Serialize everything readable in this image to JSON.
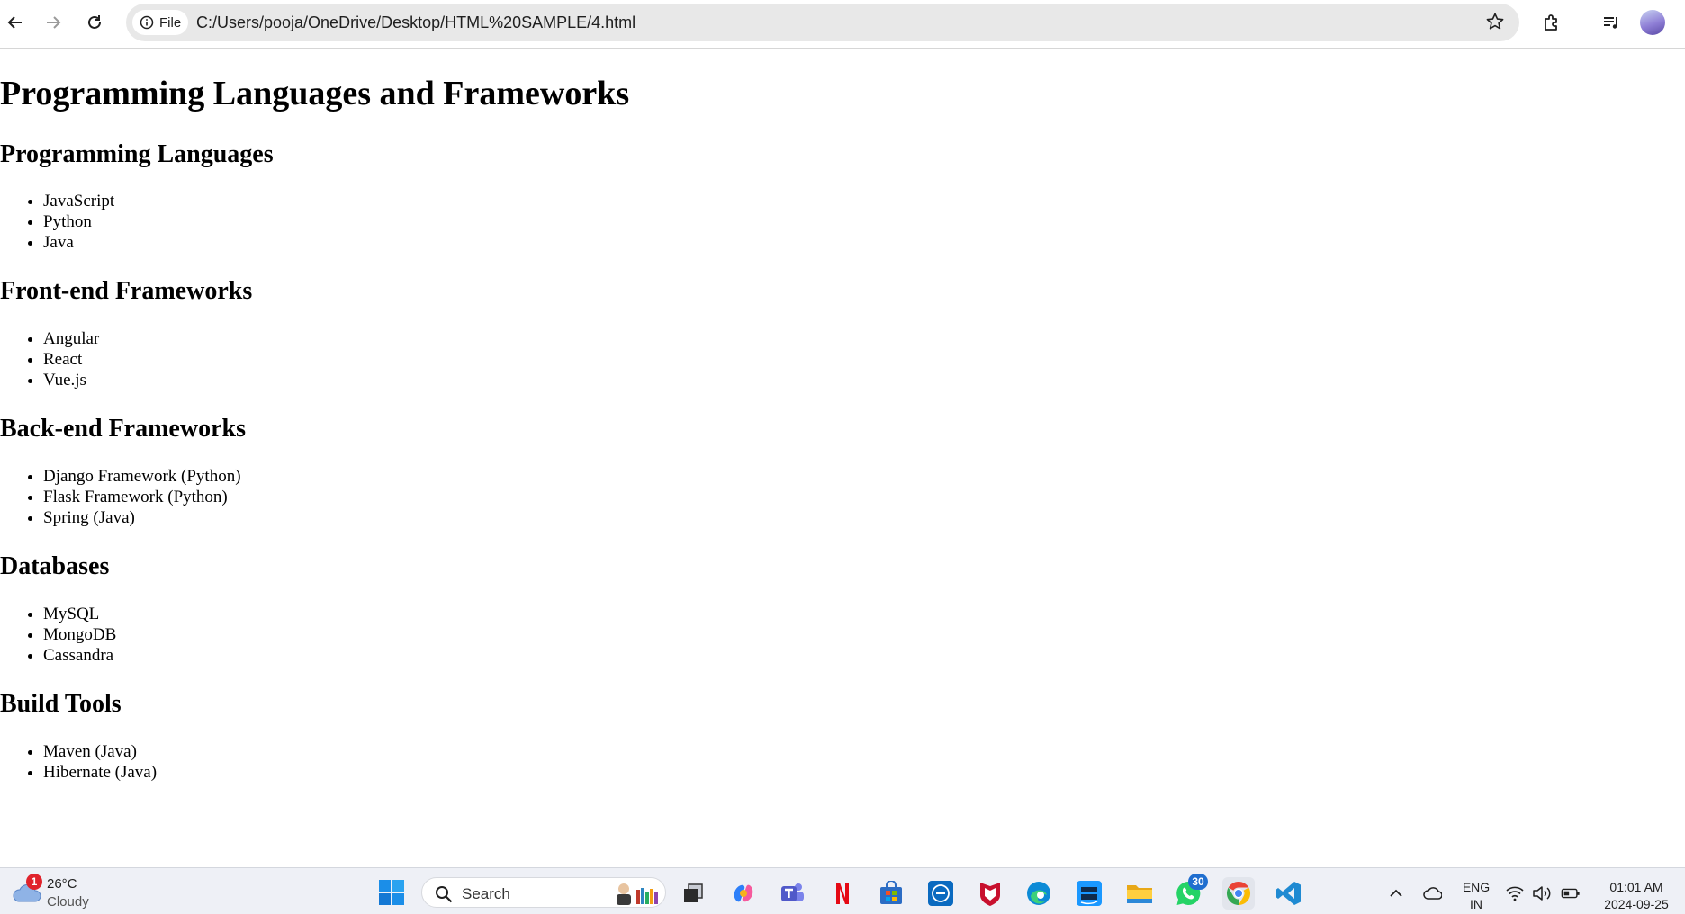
{
  "browser": {
    "site_chip_label": "File",
    "url": "C:/Users/pooja/OneDrive/Desktop/HTML%20SAMPLE/4.html"
  },
  "page": {
    "title": "Programming Languages and Frameworks",
    "sections": [
      {
        "heading": "Programming Languages",
        "items": [
          "JavaScript",
          "Python",
          "Java"
        ]
      },
      {
        "heading": "Front-end Frameworks",
        "items": [
          "Angular",
          "React",
          "Vue.js"
        ]
      },
      {
        "heading": "Back-end Frameworks",
        "items": [
          "Django Framework (Python)",
          "Flask Framework (Python)",
          "Spring (Java)"
        ]
      },
      {
        "heading": "Databases",
        "items": [
          "MySQL",
          "MongoDB",
          "Cassandra"
        ]
      },
      {
        "heading": "Build Tools",
        "items": [
          "Maven (Java)",
          "Hibernate (Java)"
        ]
      }
    ]
  },
  "taskbar": {
    "weather": {
      "badge": "1",
      "temperature": "26°C",
      "condition": "Cloudy"
    },
    "search_placeholder": "Search",
    "whatsapp_badge": "30",
    "language": {
      "line1": "ENG",
      "line2": "IN"
    },
    "clock": {
      "time": "01:01 AM",
      "date": "2024-09-25"
    }
  }
}
